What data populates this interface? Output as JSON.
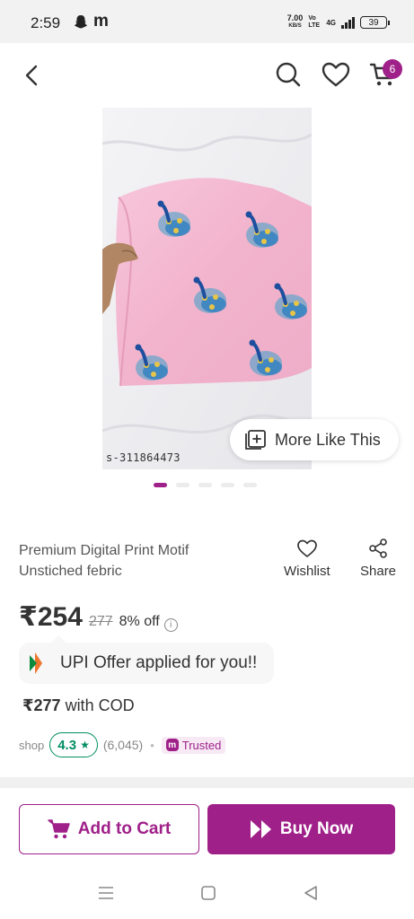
{
  "status_bar": {
    "time": "2:59",
    "notification_letter": "m",
    "net_speed_value": "7.00",
    "net_speed_unit": "KB/S",
    "volte": "Vo LTE",
    "network": "4G",
    "battery": "39"
  },
  "header": {
    "cart_count": "6",
    "icons": [
      "back-icon",
      "search-icon",
      "heart-icon",
      "cart-icon"
    ]
  },
  "product_image": {
    "code": "s-311864473",
    "more_like_label": "More Like This",
    "dots_count": 5,
    "active_dot": 0,
    "colors": {
      "fabric": "#f4b8d0",
      "bed": "#efeff1"
    }
  },
  "product": {
    "title": "Premium Digital Print  Motif\nUnstiched  febric",
    "wishlist_label": "Wishlist",
    "share_label": "Share",
    "price": "₹254",
    "mrp": "277",
    "discount": "8% off",
    "upi_offer": "UPI Offer applied for you!!",
    "cod_price": "₹277",
    "cod_label": " with COD",
    "shop_label": "shop",
    "rating": "4.3",
    "rating_count": "(6,045)",
    "trusted_label": "Trusted",
    "trusted_logo": "m"
  },
  "actions": {
    "add_to_cart": "Add to Cart",
    "buy_now": "Buy Now"
  },
  "colors": {
    "accent": "#9f2089",
    "rating_green": "#038d63"
  }
}
